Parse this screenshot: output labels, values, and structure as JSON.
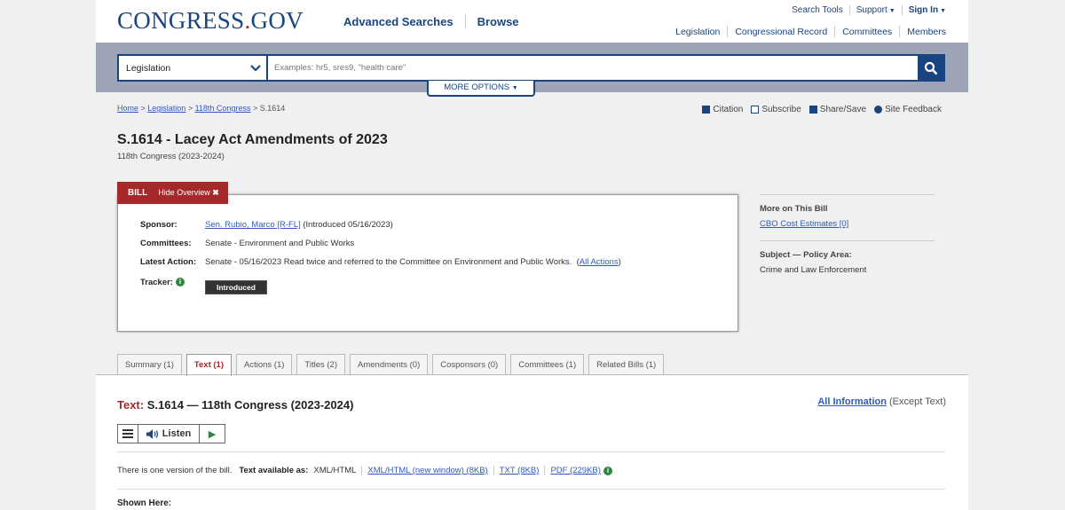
{
  "header": {
    "logo_main": "CONGRESS",
    "logo_dot": ".",
    "logo_tld": "GOV",
    "nav": [
      "Advanced Searches",
      "Browse"
    ],
    "util": {
      "search_tools": "Search Tools",
      "support": "Support",
      "sign_in": "Sign In"
    },
    "sub_nav": [
      "Legislation",
      "Congressional Record",
      "Committees",
      "Members"
    ]
  },
  "search": {
    "collection": "Legislation",
    "placeholder": "Examples: hr5, sres9, \"health care\"",
    "more_options": "MORE OPTIONS"
  },
  "breadcrumb": {
    "home": "Home",
    "legislation": "Legislation",
    "congress": "118th Congress",
    "current": "S.1614"
  },
  "tools": [
    "Citation",
    "Subscribe",
    "Share/Save",
    "Site Feedback"
  ],
  "bill": {
    "title": "S.1614 - Lacey Act Amendments of 2023",
    "congress": "118th Congress (2023-2024)",
    "tab_label": "BILL",
    "hide_overview": "Hide Overview",
    "sponsor_label": "Sponsor:",
    "sponsor_name": "Sen. Rubio, Marco [R-FL]",
    "sponsor_intro": "(Introduced 05/16/2023)",
    "committees_label": "Committees:",
    "committees_value": "Senate - Environment and Public Works",
    "latest_action_label": "Latest Action:",
    "latest_action_value": "Senate - 05/16/2023 Read twice and referred to the Committee on Environment and Public Works.",
    "all_actions": "All Actions",
    "tracker_label": "Tracker:",
    "tracker_status": "Introduced"
  },
  "side": {
    "more_heading": "More on This Bill",
    "cbo": "CBO Cost Estimates [0]",
    "subject_heading": "Subject — Policy Area:",
    "subject_value": "Crime and Law Enforcement"
  },
  "tabs": [
    {
      "label": "Summary (1)",
      "active": false
    },
    {
      "label": "Text (1)",
      "active": true
    },
    {
      "label": "Actions (1)",
      "active": false
    },
    {
      "label": "Titles (2)",
      "active": false
    },
    {
      "label": "Amendments (0)",
      "active": false
    },
    {
      "label": "Cosponsors (0)",
      "active": false
    },
    {
      "label": "Committees (1)",
      "active": false
    },
    {
      "label": "Related Bills (1)",
      "active": false
    }
  ],
  "text_section": {
    "prefix": "Text:",
    "title": "S.1614 — 118th Congress (2023-2024)",
    "all_info": "All Information",
    "except": "(Except Text)",
    "listen": "Listen",
    "versions_note": "There is one version of the bill.",
    "available_as": "Text available as:",
    "formats": [
      "XML/HTML",
      "XML/HTML (new window) (8KB)",
      "TXT (8KB)",
      "PDF (229KB)"
    ],
    "shown_here": "Shown Here:"
  },
  "colors": {
    "brand_blue": "#1a4480",
    "brand_red": "#a5292a",
    "link": "#2f5bb7",
    "status_green": "#2e8540"
  }
}
